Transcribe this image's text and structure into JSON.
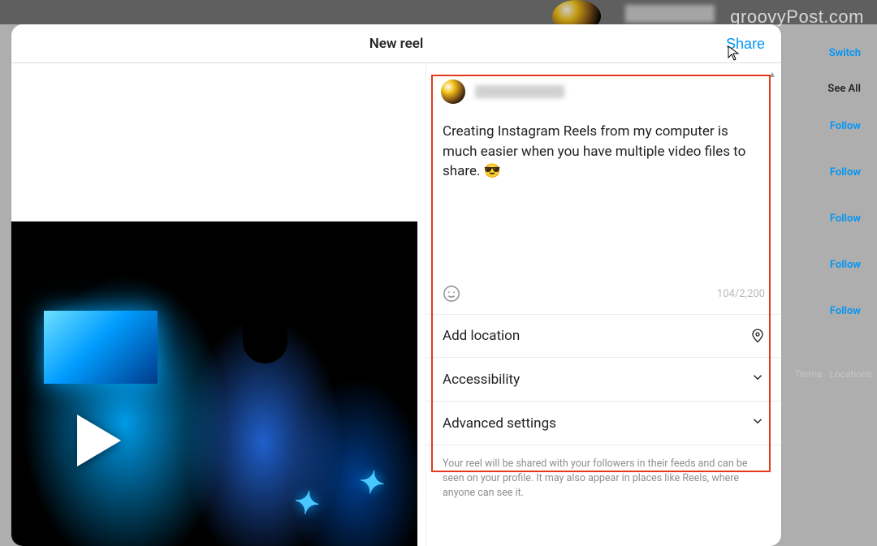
{
  "watermark": "groovyPost.com",
  "background": {
    "switch_label": "Switch",
    "see_all_label": "See All",
    "follow_label": "Follow",
    "follow_count": 5,
    "footer_terms": "Terms",
    "footer_locations": "Locations"
  },
  "modal": {
    "title": "New reel",
    "share_label": "Share",
    "caption_text": "Creating Instagram Reels from my computer is much easier when you have multiple video files to share. 😎",
    "char_counter": "104/2,200",
    "add_location_label": "Add location",
    "accessibility_label": "Accessibility",
    "advanced_label": "Advanced settings",
    "disclosure_text": "Your reel will be shared with your followers in their feeds and can be seen on your profile. It may also appear in places like Reels, where anyone can see it."
  }
}
